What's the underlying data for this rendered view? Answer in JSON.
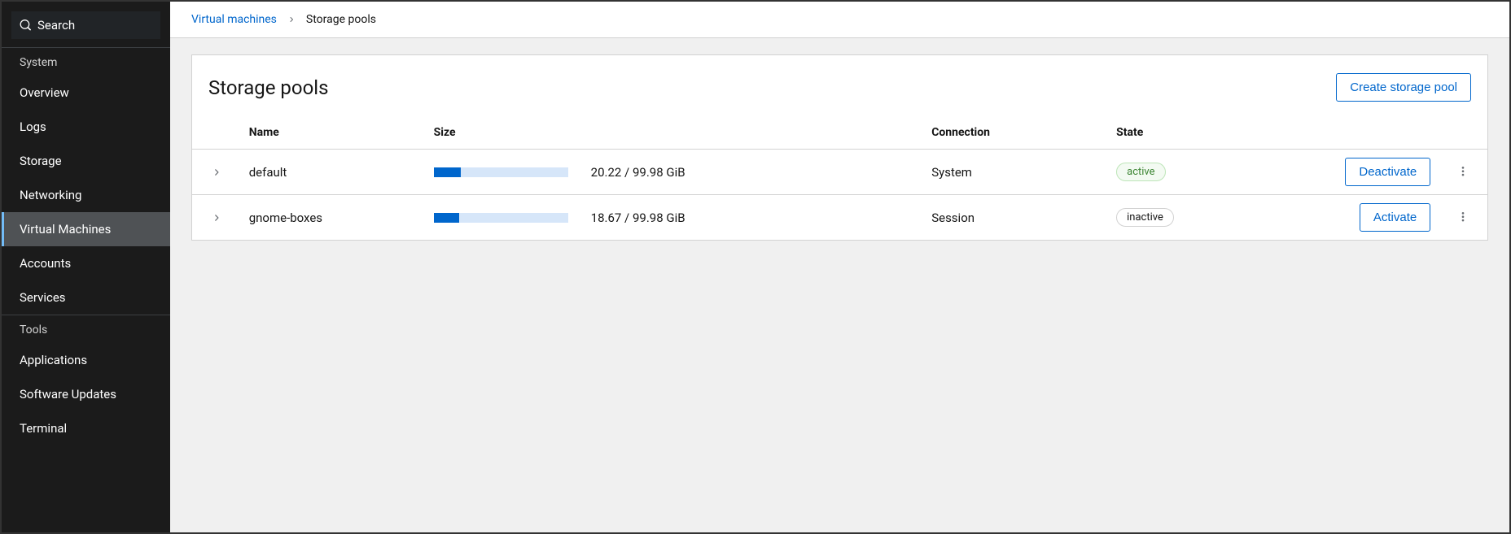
{
  "sidebar": {
    "search_label": "Search",
    "sections": [
      {
        "label": "System",
        "items": [
          {
            "label": "Overview",
            "active": false
          },
          {
            "label": "Logs",
            "active": false
          },
          {
            "label": "Storage",
            "active": false
          },
          {
            "label": "Networking",
            "active": false
          },
          {
            "label": "Virtual Machines",
            "active": true
          },
          {
            "label": "Accounts",
            "active": false
          },
          {
            "label": "Services",
            "active": false
          }
        ]
      },
      {
        "label": "Tools",
        "items": [
          {
            "label": "Applications",
            "active": false
          },
          {
            "label": "Software Updates",
            "active": false
          },
          {
            "label": "Terminal",
            "active": false
          }
        ]
      }
    ]
  },
  "breadcrumb": {
    "parent": "Virtual machines",
    "current": "Storage pools"
  },
  "page": {
    "title": "Storage pools",
    "create_button": "Create storage pool"
  },
  "table": {
    "headers": {
      "name": "Name",
      "size": "Size",
      "connection": "Connection",
      "state": "State"
    },
    "rows": [
      {
        "name": "default",
        "used": 20.22,
        "total": 99.98,
        "unit": "GiB",
        "size_text": "20.22 / 99.98 GiB",
        "percent": 20.2,
        "connection": "System",
        "state": "active",
        "state_class": "active",
        "action_label": "Deactivate"
      },
      {
        "name": "gnome-boxes",
        "used": 18.67,
        "total": 99.98,
        "unit": "GiB",
        "size_text": "18.67 / 99.98 GiB",
        "percent": 18.7,
        "connection": "Session",
        "state": "inactive",
        "state_class": "inactive",
        "action_label": "Activate"
      }
    ]
  }
}
